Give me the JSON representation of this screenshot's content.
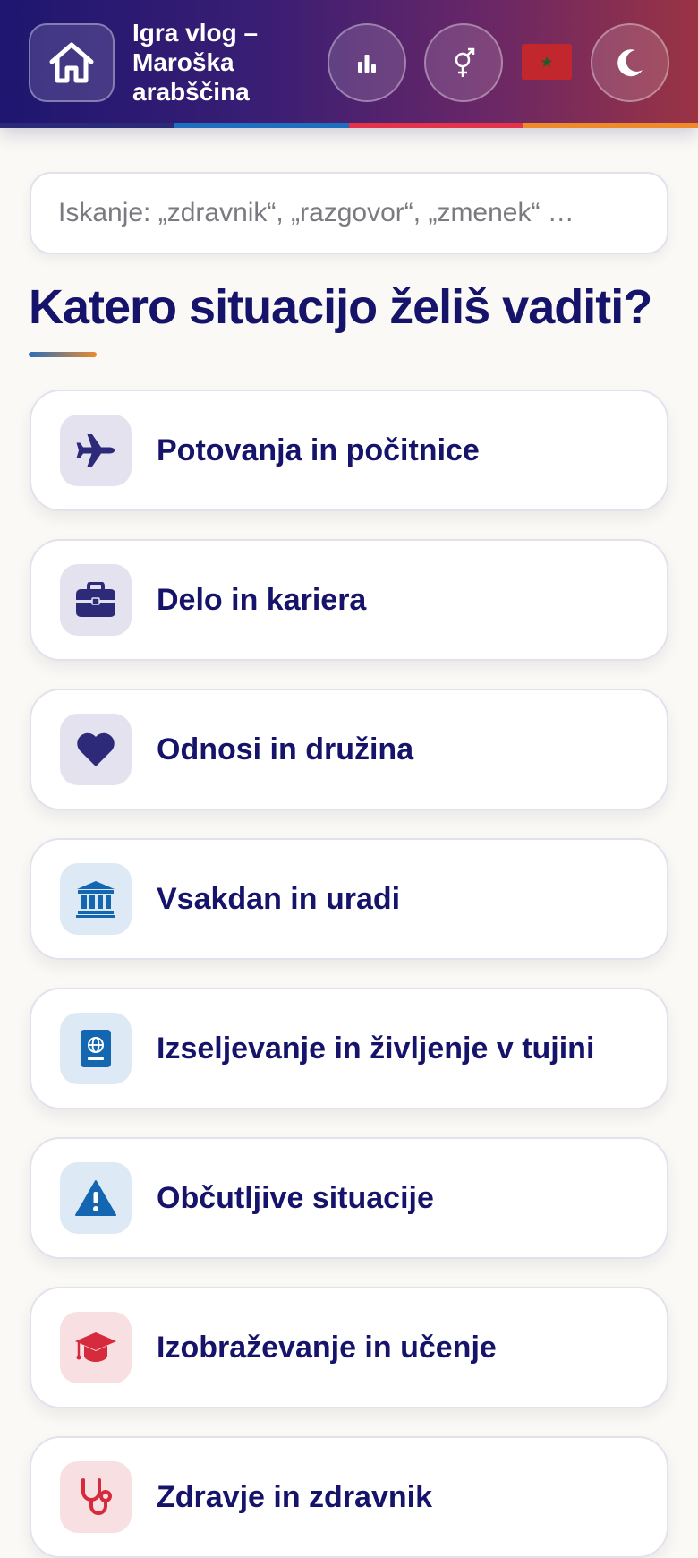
{
  "header": {
    "title": "Igra vlog – Maroška arabščina",
    "home_icon": "home-icon",
    "stats_icon": "bar-chart-icon",
    "gender_icon": "gender-icon",
    "flag": "morocco-flag",
    "theme_icon": "moon-icon",
    "stripe_colors": [
      "#2b2a78",
      "#1f6fc0",
      "#e2334b",
      "#ef8a2a"
    ]
  },
  "search": {
    "placeholder": "Iskanje: „zdravnik“, „razgovor“, „zmenek“ …",
    "value": ""
  },
  "main": {
    "heading": "Katero situacijo želiš vaditi?",
    "categories": [
      {
        "label": "Potovanja in počitnice",
        "icon": "airplane-icon",
        "color": "#2e2a7a"
      },
      {
        "label": "Delo in kariera",
        "icon": "briefcase-icon",
        "color": "#2e2a7a"
      },
      {
        "label": "Odnosi in družina",
        "icon": "heart-icon",
        "color": "#2e2a7a"
      },
      {
        "label": "Vsakdan in uradi",
        "icon": "bank-icon",
        "color": "#1566b0"
      },
      {
        "label": "Izseljevanje in življenje v tujini",
        "icon": "passport-icon",
        "color": "#1566b0"
      },
      {
        "label": "Občutljive situacije",
        "icon": "warning-icon",
        "color": "#1566b0"
      },
      {
        "label": "Izobraževanje in učenje",
        "icon": "graduation-cap-icon",
        "color": "#d62b3c"
      },
      {
        "label": "Zdravje in zdravnik",
        "icon": "stethoscope-icon",
        "color": "#d62b3c"
      }
    ]
  }
}
